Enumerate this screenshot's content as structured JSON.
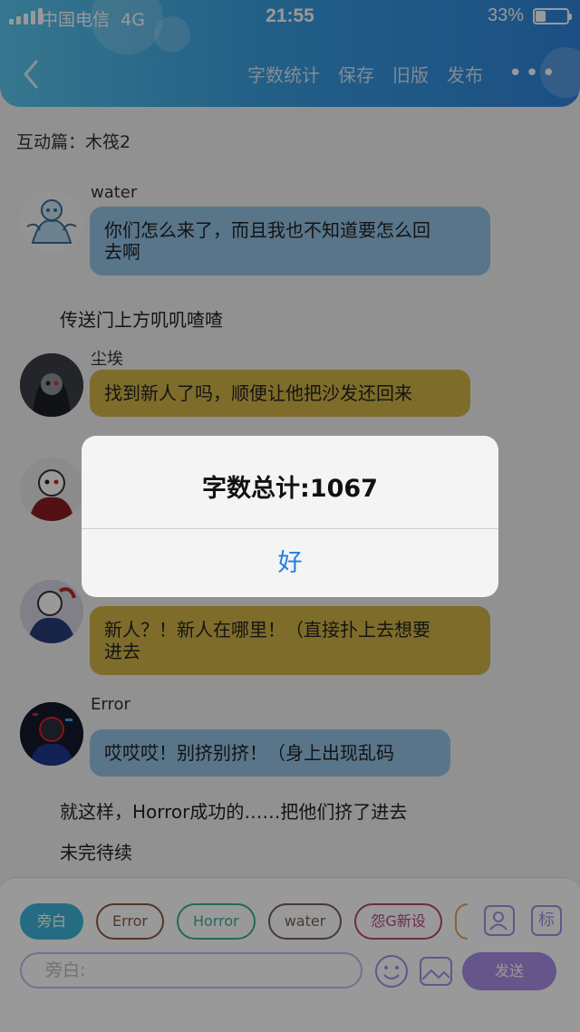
{
  "status_bar": {
    "carrier": "中国电信",
    "network": "4G",
    "time": "21:55",
    "battery": "33%",
    "battery_level": 0.33
  },
  "nav": {
    "back_icon": "chevron-left-icon",
    "actions": [
      "字数统计",
      "保存",
      "旧版",
      "发布"
    ],
    "more_icon": "ellipsis-icon"
  },
  "topic": "互动篇：木筏2",
  "messages": [
    {
      "name": "water",
      "text_line1": "你们怎么来了，而且我也不知道要怎么回",
      "text_line2": "去啊"
    },
    {
      "narration": "传送门上方叽叽喳喳"
    },
    {
      "name": "尘埃",
      "text": "找到新人了吗，顺便让他把沙发还回来"
    },
    {
      "text_line1": "新人？！新人在哪里！（直接扑上去想要",
      "text_line2": "进去"
    },
    {
      "name": "Error",
      "text": "哎哎哎！别挤别挤！（身上出现乱码"
    },
    {
      "narration": "就这样，Horror成功的……把他们挤了进去"
    },
    {
      "narration": "未完待续"
    }
  ],
  "alert": {
    "title": "字数总计:1067",
    "button": "好"
  },
  "composer": {
    "roles": [
      {
        "label": "旁白",
        "color": "#3fb5d9",
        "filled": true
      },
      {
        "label": "Error",
        "color": "#8a5a48",
        "filled": false
      },
      {
        "label": "Horror",
        "color": "#3fae9a",
        "filled": false
      },
      {
        "label": "water",
        "color": "#7a6058",
        "filled": false
      },
      {
        "label": "怨G新设",
        "color": "#b04a7e",
        "filled": false
      }
    ],
    "placeholder": "旁白:",
    "send_label": "发送",
    "accent_color": "#a88ee6",
    "icons": [
      "role-avatar-icon",
      "tag-icon",
      "emoji-icon",
      "image-icon"
    ],
    "tag_label": "标"
  }
}
